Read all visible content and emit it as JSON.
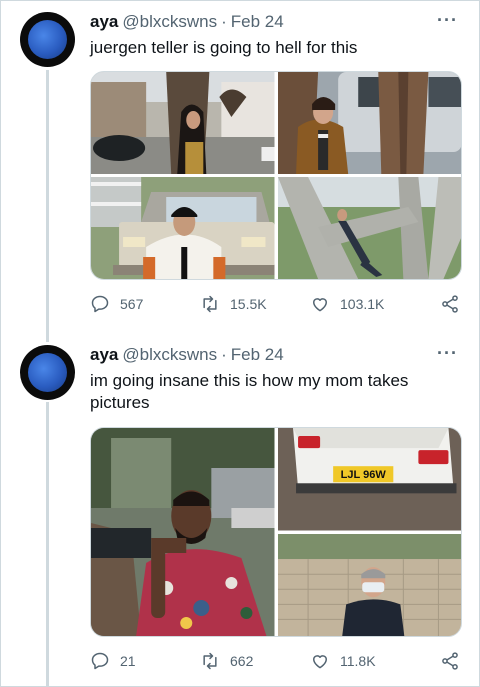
{
  "tweets": [
    {
      "author": {
        "name": "aya",
        "handle": "@blxckswns"
      },
      "separator": "·",
      "date": "Feb 24",
      "text": "juergen teller is going to hell for this",
      "photos": [
        "woman leaning on tree trunk on street",
        "man in brown jacket by tree and car",
        "man in white shirt in front of old truck",
        "man in suit lying on tree branches"
      ],
      "stats": {
        "replies": "567",
        "retweets": "15.5K",
        "likes": "103.1K"
      }
    },
    {
      "author": {
        "name": "aya",
        "handle": "@blxckswns"
      },
      "separator": "·",
      "date": "Feb 24",
      "text": "im going insane this is how my mom takes pictures",
      "photos": [
        "man in floral shirt sitting by tree",
        "white car rear with license plate",
        "man in face mask by stone wall"
      ],
      "license_plate": "LJL 96W",
      "stats": {
        "replies": "21",
        "retweets": "662",
        "likes": "11.8K"
      }
    }
  ],
  "icons": {
    "reply": "reply-icon",
    "retweet": "retweet-icon",
    "like": "heart-icon",
    "share": "share-icon",
    "more": "more-icon"
  },
  "colors": {
    "text": "#0f1419",
    "secondary": "#536471",
    "border": "#cfd9de",
    "avatar_bg": "#0b0b0b",
    "moon": "#2a5cc0"
  }
}
